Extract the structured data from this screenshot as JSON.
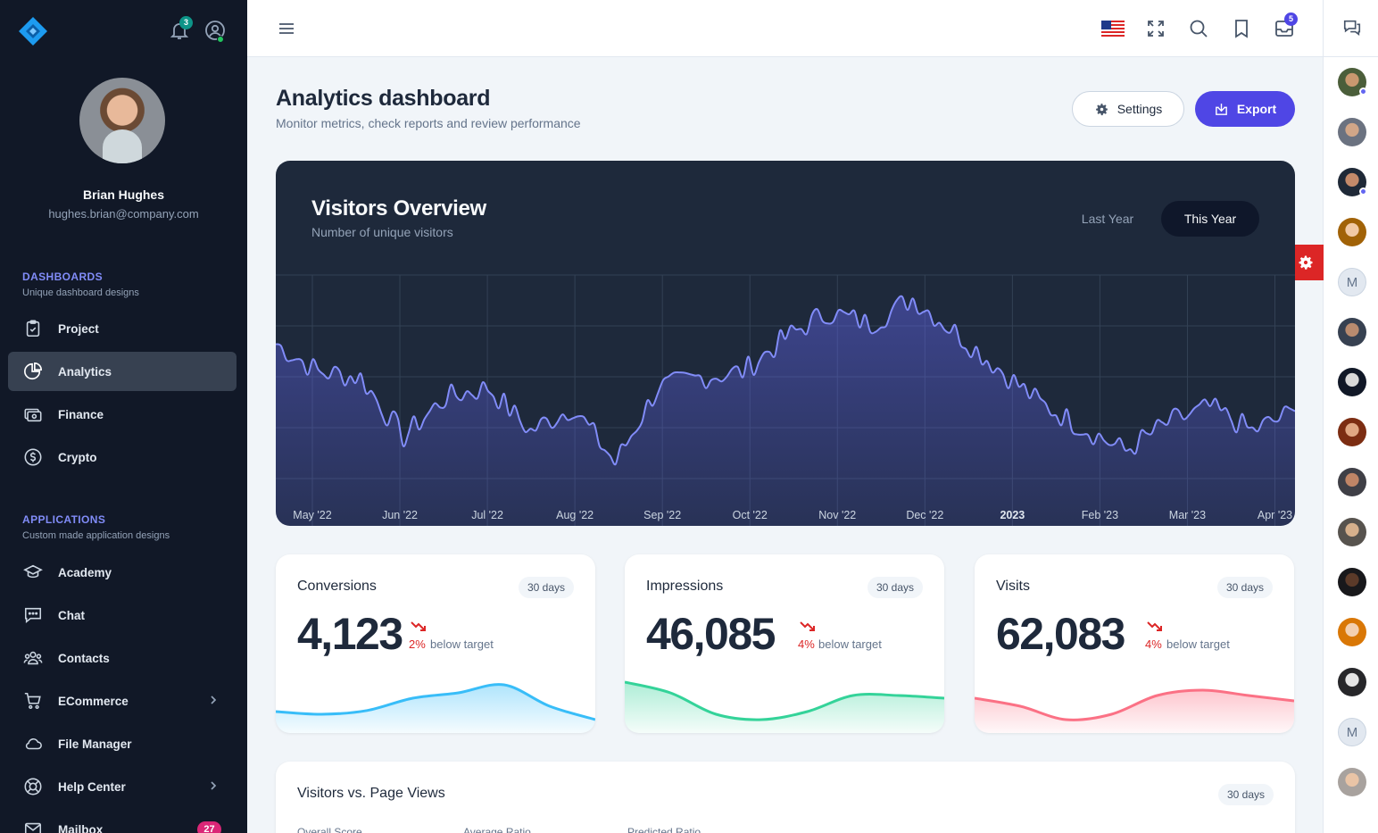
{
  "sidebar": {
    "notifications_count": "3",
    "user": {
      "name": "Brian Hughes",
      "email": "hughes.brian@company.com"
    },
    "sections": [
      {
        "title": "DASHBOARDS",
        "subtitle": "Unique dashboard designs"
      },
      {
        "title": "APPLICATIONS",
        "subtitle": "Custom made application designs"
      }
    ],
    "items": [
      {
        "label": "Project",
        "icon": "clipboard-check-icon"
      },
      {
        "label": "Analytics",
        "icon": "chart-pie-icon",
        "active": true
      },
      {
        "label": "Finance",
        "icon": "cash-icon"
      },
      {
        "label": "Crypto",
        "icon": "currency-dollar-icon"
      },
      {
        "label": "Academy",
        "icon": "academic-cap-icon"
      },
      {
        "label": "Chat",
        "icon": "chat-alt-icon"
      },
      {
        "label": "Contacts",
        "icon": "user-group-icon"
      },
      {
        "label": "ECommerce",
        "icon": "shopping-cart-icon"
      },
      {
        "label": "File Manager",
        "icon": "cloud-icon"
      },
      {
        "label": "Help Center",
        "icon": "support-icon"
      },
      {
        "label": "Mailbox",
        "icon": "mail-icon",
        "badge": "27"
      }
    ]
  },
  "topbar": {
    "mail_count": "5"
  },
  "header": {
    "title": "Analytics dashboard",
    "subtitle": "Monitor metrics, check reports and review performance",
    "settings_label": "Settings",
    "export_label": "Export"
  },
  "visitors": {
    "title": "Visitors Overview",
    "subtitle": "Number of unique visitors",
    "tab_last": "Last Year",
    "tab_this": "This Year"
  },
  "chart_data": [
    {
      "type": "area",
      "title": "Visitors Overview",
      "x": [
        "May '22",
        "Jun '22",
        "Jul '22",
        "Aug '22",
        "Sep '22",
        "Oct '22",
        "Nov '22",
        "Dec '22",
        "2023",
        "Feb '23",
        "Mar '23",
        "Apr '23"
      ],
      "values": [
        0.72,
        0.58,
        0.55,
        0.25,
        0.45,
        0.5,
        0.28,
        0.4,
        0.12,
        0.5,
        0.55,
        0.58,
        0.75,
        0.88,
        0.82,
        0.95,
        0.78,
        0.6,
        0.42,
        0.3,
        0.18,
        0.32,
        0.4,
        0.28,
        0.38
      ],
      "grid": true,
      "accent": "#818cf8"
    },
    {
      "type": "area",
      "title": "Conversions",
      "values": [
        0.2,
        0.15,
        0.22,
        0.45,
        0.55,
        0.7,
        0.3,
        0.05
      ],
      "color": "#38bdf8"
    },
    {
      "type": "area",
      "title": "Impressions",
      "values": [
        0.75,
        0.55,
        0.15,
        0.05,
        0.2,
        0.5,
        0.5,
        0.45
      ],
      "color": "#34d399"
    },
    {
      "type": "area",
      "title": "Visits",
      "values": [
        0.45,
        0.3,
        0.05,
        0.15,
        0.5,
        0.6,
        0.5,
        0.4
      ],
      "color": "#fb7185"
    }
  ],
  "kpis": [
    {
      "title": "Conversions",
      "period": "30 days",
      "value": "4,123",
      "pct": "2%",
      "note": "below target"
    },
    {
      "title": "Impressions",
      "period": "30 days",
      "value": "46,085",
      "pct": "4%",
      "note": "below target"
    },
    {
      "title": "Visits",
      "period": "30 days",
      "value": "62,083",
      "pct": "4%",
      "note": "below target"
    }
  ],
  "bottom": {
    "title": "Visitors vs. Page Views",
    "period": "30 days",
    "stats": [
      "Overall Score",
      "Average Ratio",
      "Predicted Ratio"
    ]
  },
  "rail": {
    "letters": [
      "M",
      "M"
    ]
  },
  "colors": {
    "brand": "#4f46e5",
    "sidebar": "#111827",
    "danger": "#dc2626"
  }
}
